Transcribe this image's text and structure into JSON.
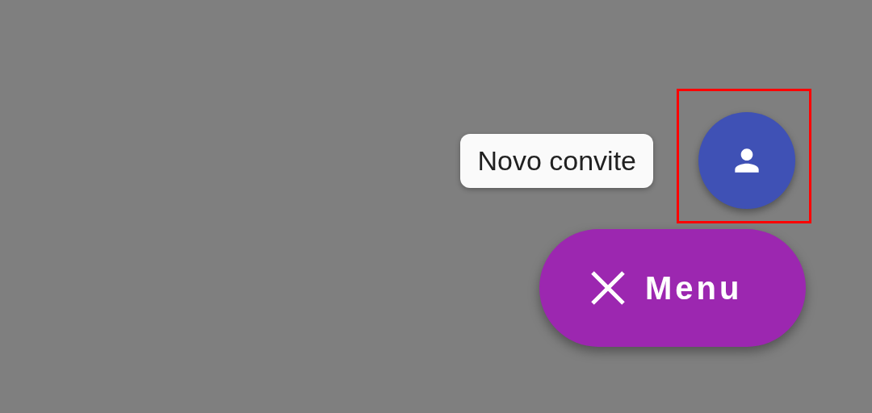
{
  "speed_dial": {
    "actions": [
      {
        "label": "Novo convite",
        "highlighted": true
      }
    ],
    "main_button": {
      "label": "Menu",
      "expanded": true
    }
  }
}
